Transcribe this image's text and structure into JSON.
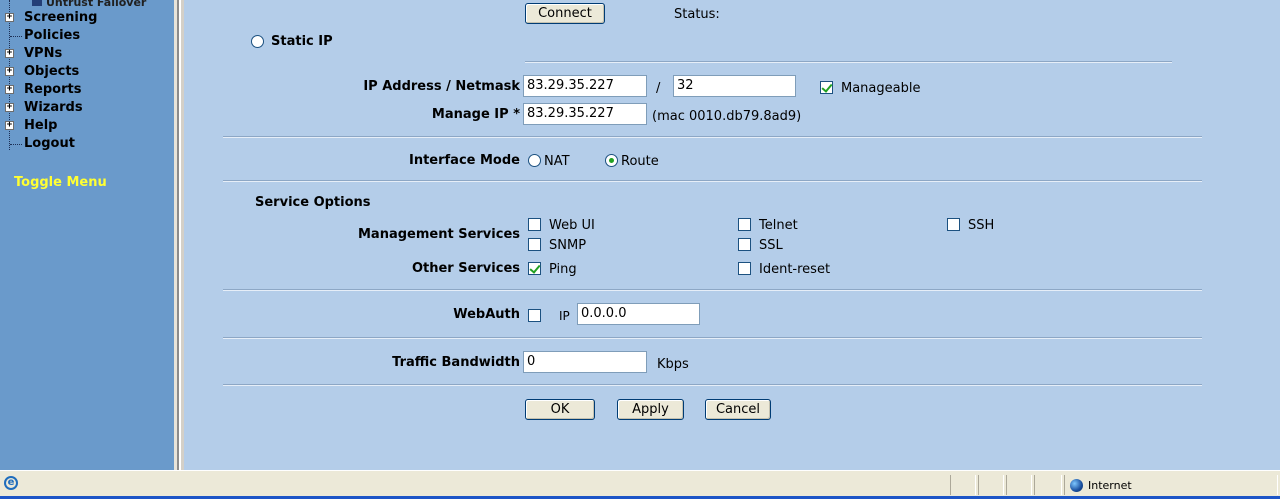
{
  "sidebar": {
    "partial_item": "Untrust Failover",
    "items": [
      {
        "label": "Screening",
        "expander": "+"
      },
      {
        "label": "Policies",
        "expander": ""
      },
      {
        "label": "VPNs",
        "expander": "+"
      },
      {
        "label": "Objects",
        "expander": "+"
      },
      {
        "label": "Reports",
        "expander": "+"
      },
      {
        "label": "Wizards",
        "expander": "+"
      },
      {
        "label": "Help",
        "expander": "+"
      },
      {
        "label": "Logout",
        "expander": ""
      }
    ],
    "toggle_menu": "Toggle Menu"
  },
  "form": {
    "connect_button": "Connect",
    "status_label": "Status:",
    "static_ip_label": "Static IP",
    "ip_netmask_label": "IP Address / Netmask",
    "ip_address": "83.29.35.227",
    "slash": "/",
    "netmask": "32",
    "manageable_label": "Manageable",
    "manageable_checked": true,
    "manage_ip_label": "Manage IP *",
    "manage_ip": "83.29.35.227",
    "mac_text": "(mac 0010.db79.8ad9)",
    "interface_mode_label": "Interface Mode",
    "mode_nat": "NAT",
    "mode_route": "Route",
    "mode_selected": "Route",
    "service_options_heading": "Service Options",
    "management_services_label": "Management Services",
    "other_services_label": "Other Services",
    "services": {
      "web_ui": {
        "label": "Web UI",
        "checked": false
      },
      "telnet": {
        "label": "Telnet",
        "checked": false
      },
      "ssh": {
        "label": "SSH",
        "checked": false
      },
      "snmp": {
        "label": "SNMP",
        "checked": false
      },
      "ssl": {
        "label": "SSL",
        "checked": false
      },
      "ping": {
        "label": "Ping",
        "checked": true
      },
      "ident_reset": {
        "label": "Ident-reset",
        "checked": false
      }
    },
    "webauth_label": "WebAuth",
    "webauth_checked": false,
    "webauth_ip_label": "IP",
    "webauth_ip": "0.0.0.0",
    "traffic_bandwidth_label": "Traffic Bandwidth",
    "traffic_bandwidth": "0",
    "bandwidth_unit": "Kbps",
    "ok_button": "OK",
    "apply_button": "Apply",
    "cancel_button": "Cancel"
  },
  "statusbar": {
    "zone": "Internet"
  }
}
